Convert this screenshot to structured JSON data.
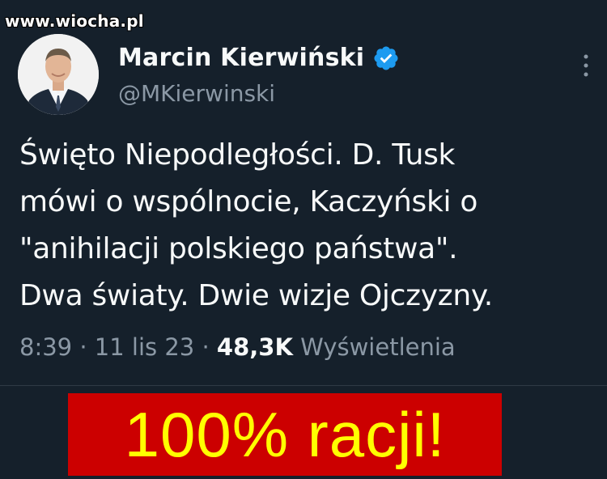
{
  "watermark": "www.wiocha.pl",
  "tweet": {
    "display_name": "Marcin Kierwiński",
    "handle": "@MKierwinski",
    "text_lines": [
      "Święto Niepodległości. D. Tusk",
      "mówi o wspólnocie, Kaczyński o",
      "\"anihilacji polskiego państwa\".",
      "Dwa światy. Dwie wizje Ojczyzny."
    ],
    "time": "8:39",
    "separator": "·",
    "date": "11 lis 23",
    "views_count": "48,3K",
    "views_label": "Wyświetlenia"
  },
  "banner": {
    "text": "100% racji!"
  },
  "colors": {
    "background": "#15202b",
    "verified": "#1d9bf0",
    "banner_background": "#cc0000",
    "banner_text": "#ffff00"
  },
  "icons": {
    "verified": "verified-badge-icon",
    "more": "more-vertical-icon"
  }
}
